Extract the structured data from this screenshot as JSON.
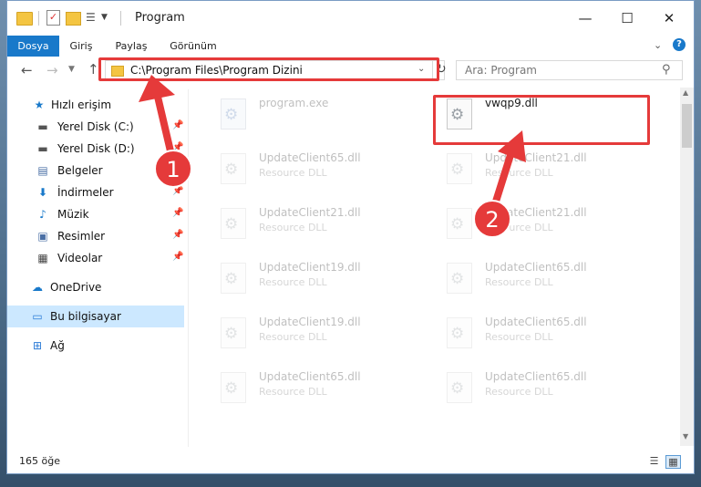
{
  "window": {
    "title": "Program",
    "buttons": {
      "minimize": "—",
      "maximize": "☐",
      "close": "✕"
    }
  },
  "ribbon": {
    "tabs": [
      "Dosya",
      "Giriş",
      "Paylaş",
      "Görünüm"
    ],
    "help": "?"
  },
  "address": {
    "path": "C:\\Program Files\\Program Dizini",
    "search_placeholder": "Ara: Program"
  },
  "sidebar": {
    "items": [
      {
        "label": "Hızlı erişim",
        "icon": "star-icon",
        "color": "#1979ca"
      },
      {
        "label": "Yerel Disk (C:)",
        "icon": "drive-icon",
        "pinned": true
      },
      {
        "label": "Yerel Disk (D:)",
        "icon": "drive-icon",
        "pinned": true
      },
      {
        "label": "Belgeler",
        "icon": "documents-icon",
        "pinned": true
      },
      {
        "label": "İndirmeler",
        "icon": "download-icon",
        "pinned": true
      },
      {
        "label": "Müzik",
        "icon": "music-icon",
        "pinned": true
      },
      {
        "label": "Resimler",
        "icon": "pictures-icon",
        "pinned": true
      },
      {
        "label": "Videolar",
        "icon": "videos-icon",
        "pinned": true
      },
      {
        "label": "OneDrive",
        "icon": "cloud-icon"
      },
      {
        "label": "Bu bilgisayar",
        "icon": "computer-icon",
        "selected": true
      },
      {
        "label": "Ağ",
        "icon": "network-icon"
      }
    ]
  },
  "files": [
    {
      "name": "program.exe",
      "type": "",
      "kind": "exe",
      "faded": true
    },
    {
      "name": "vwqp9.dll",
      "type": "",
      "kind": "dll",
      "faded": false
    },
    {
      "name": "UpdateClient65.dll",
      "type": "Resource DLL",
      "kind": "dll",
      "faded": true
    },
    {
      "name": "UpdateClient21.dll",
      "type": "Resource DLL",
      "kind": "dll",
      "faded": true
    },
    {
      "name": "UpdateClient21.dll",
      "type": "Resource DLL",
      "kind": "dll",
      "faded": true
    },
    {
      "name": "UpdateClient21.dll",
      "type": "Resource DLL",
      "kind": "dll",
      "faded": true
    },
    {
      "name": "UpdateClient19.dll",
      "type": "Resource DLL",
      "kind": "dll",
      "faded": true
    },
    {
      "name": "UpdateClient65.dll",
      "type": "Resource DLL",
      "kind": "dll",
      "faded": true
    },
    {
      "name": "UpdateClient19.dll",
      "type": "Resource DLL",
      "kind": "dll",
      "faded": true
    },
    {
      "name": "UpdateClient65.dll",
      "type": "Resource DLL",
      "kind": "dll",
      "faded": true
    },
    {
      "name": "UpdateClient65.dll",
      "type": "Resource DLL",
      "kind": "dll",
      "faded": true
    },
    {
      "name": "UpdateClient65.dll",
      "type": "Resource DLL",
      "kind": "dll",
      "faded": true
    }
  ],
  "status": {
    "item_count": "165 öğe"
  },
  "annotations": {
    "step1": "1",
    "step2": "2",
    "color": "#e53a3a"
  }
}
